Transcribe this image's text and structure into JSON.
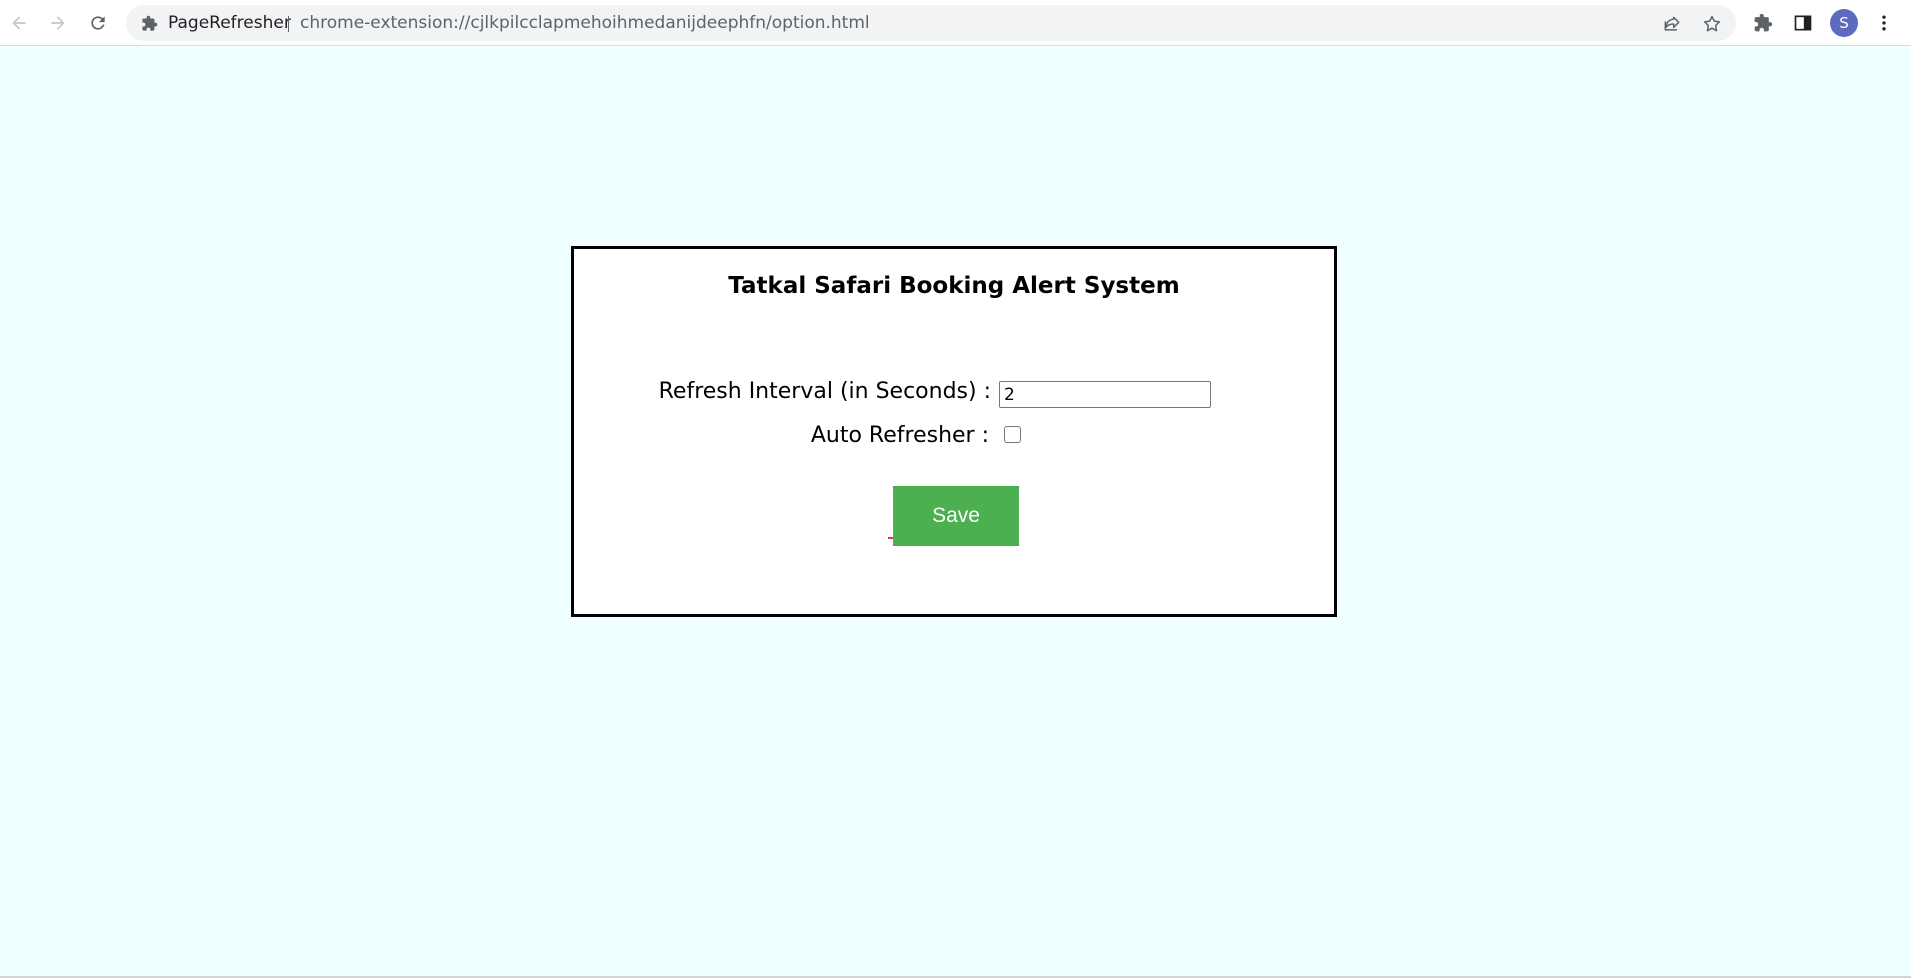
{
  "browser": {
    "site_name": "PageRefresher",
    "url": "chrome-extension://cjlkpilcclapmehoihmedanijdeephfn/option.html",
    "profile_initial": "S",
    "icons": [
      "back-arrow-icon",
      "forward-arrow-icon",
      "reload-icon",
      "extension-puzzle-icon",
      "share-icon",
      "star-icon",
      "extensions-icon",
      "side-panel-icon",
      "kebab-menu-icon"
    ]
  },
  "form": {
    "title": "Tatkal Safari Booking Alert System",
    "interval_label": "Refresh Interval (in Seconds) :",
    "interval_value": "2",
    "auto_label": "Auto Refresher :",
    "auto_checked": false,
    "save_label": "Save"
  },
  "colors": {
    "page_background": "#f0ffff",
    "save_button": "#4caf50",
    "avatar": "#5c6bc0"
  }
}
